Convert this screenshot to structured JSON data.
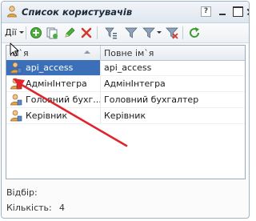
{
  "window": {
    "title": "Список користувачів"
  },
  "toolbar": {
    "actions_label": "Дії",
    "icons": [
      "add-icon",
      "copy-icon",
      "edit-pencil-icon",
      "delete-icon",
      "filter-settings-icon",
      "filter-icon",
      "filter-dropdown-icon",
      "clear-filter-icon",
      "refresh-icon"
    ]
  },
  "table": {
    "columns": [
      "Ім`я",
      "Повне ім`я"
    ],
    "rows": [
      {
        "name": "api_access",
        "full_name": "api_access",
        "icon": "user-icon"
      },
      {
        "name": "АдмінІнтегра",
        "full_name": "АдмінІнтегра",
        "icon": "user-admin-icon"
      },
      {
        "name": "Головний бухг...",
        "full_name": "Головний бухгалтер",
        "icon": "user-icon"
      },
      {
        "name": "Керівник",
        "full_name": "Керівник",
        "icon": "user-icon"
      }
    ]
  },
  "footer": {
    "selection_label": "Відбір:",
    "selection_value": "",
    "count_label": "Кількість:",
    "count_value": "4"
  },
  "colors": {
    "selection": "#3b70b8",
    "annotation_arrow": "#e0242c",
    "title_text": "#1c2a3a"
  }
}
